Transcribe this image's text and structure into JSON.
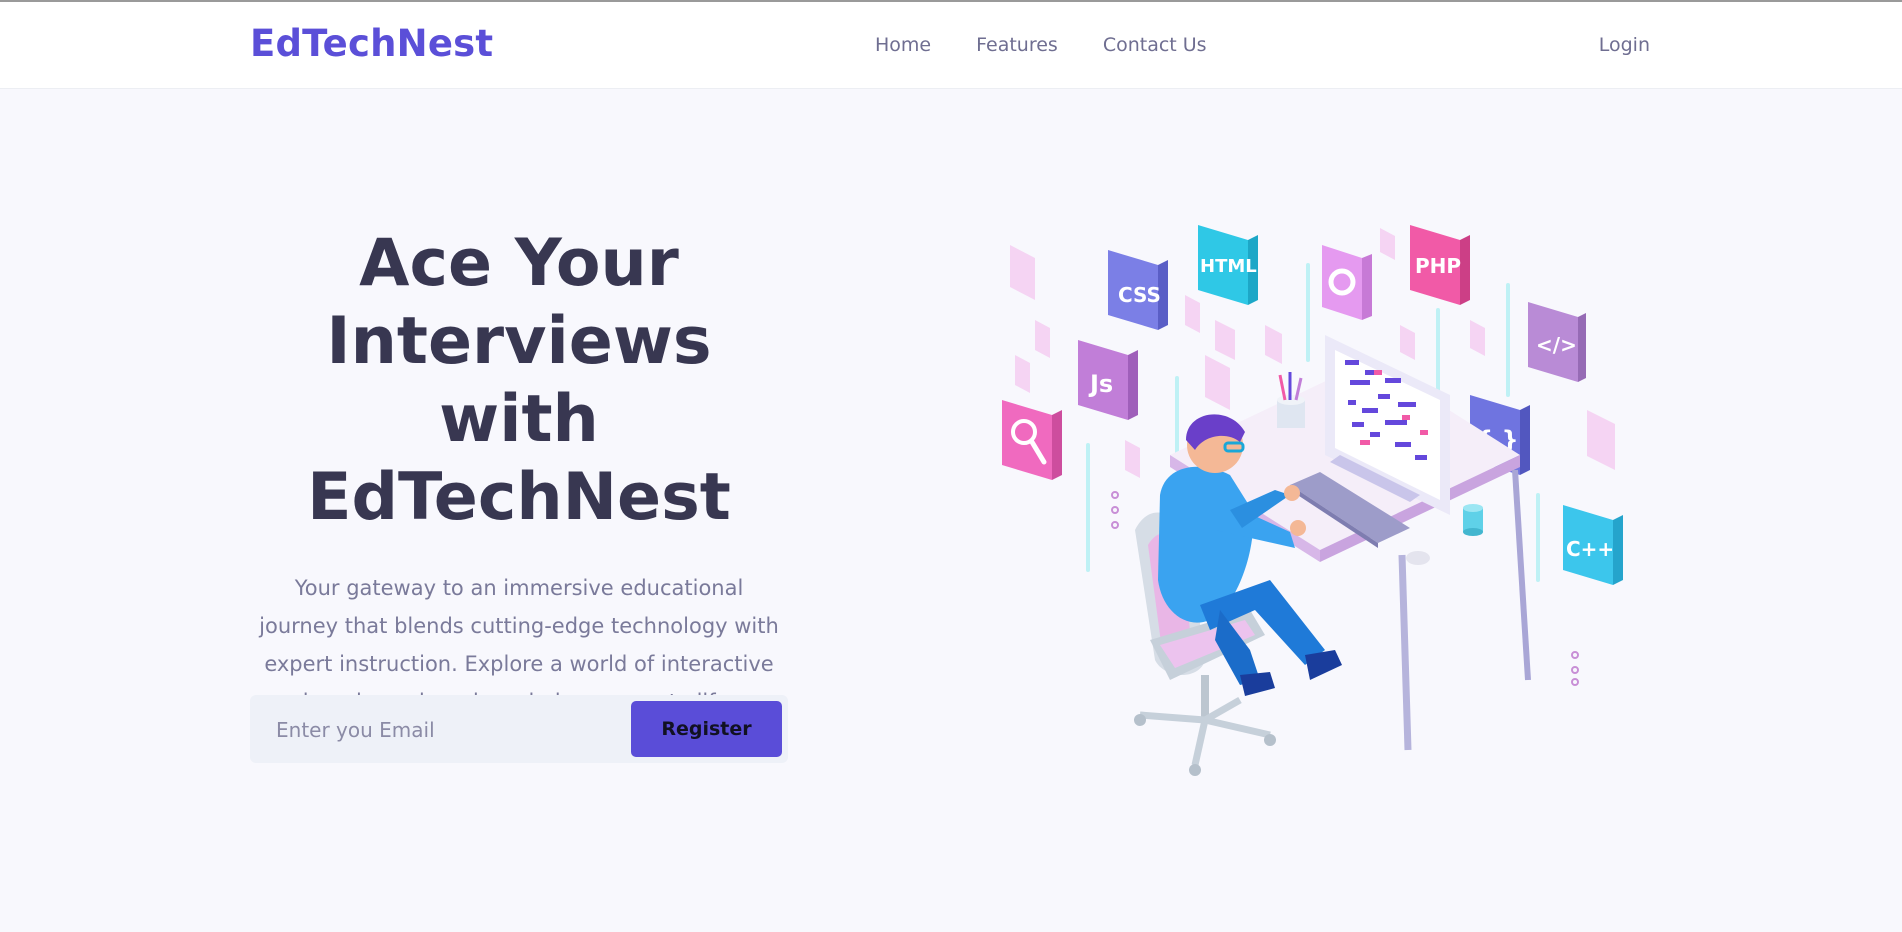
{
  "brand": {
    "name": "EdTechNest"
  },
  "nav": {
    "links": [
      {
        "label": "Home"
      },
      {
        "label": "Features"
      },
      {
        "label": "Contact Us"
      }
    ],
    "login_label": "Login"
  },
  "hero": {
    "title_lines": [
      "Ace Your",
      "Interviews with",
      "EdTechNest"
    ],
    "description": "Your gateway to an immersive educational journey that blends cutting-edge technology with expert instruction. Explore a world of interactive learning, where knowledge comes to life.",
    "email_placeholder": "Enter you Email",
    "email_value": "",
    "register_label": "Register"
  },
  "illustration": {
    "tiles": [
      {
        "label": "CSS",
        "color": "#7b7fe6"
      },
      {
        "label": "HTML",
        "color": "#2fc8e6"
      },
      {
        "label": "PHP",
        "color": "#f15aa7"
      },
      {
        "label": "Js",
        "color": "#c17ed8"
      },
      {
        "label": "</>",
        "color": "#b98bd6"
      },
      {
        "label": "{ }",
        "color": "#6f74e0"
      },
      {
        "label": "C++",
        "color": "#3cc6ec"
      }
    ]
  },
  "colors": {
    "accent": "#5a4dd8",
    "text_dark": "#383751",
    "text_muted": "#7a7a9a",
    "background": "#f8f8fd"
  }
}
